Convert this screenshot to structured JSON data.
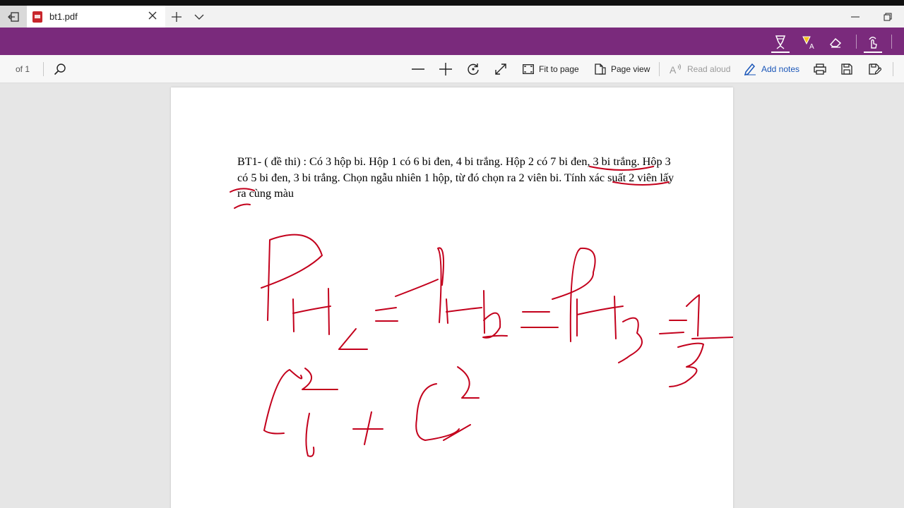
{
  "browser": {
    "tab_title": "bt1.pdf",
    "icons": {
      "back": "set-aside-tabs-icon",
      "favicon": "pdf-file-icon",
      "close": "close-icon",
      "new_tab": "plus-icon",
      "tab_list": "chevron-down-icon",
      "minimize": "minimize-icon",
      "restore": "restore-icon"
    }
  },
  "ink_toolbar": {
    "tools": [
      "ballpoint-pen-icon",
      "highlighter-icon",
      "eraser-icon",
      "touch-writing-icon"
    ],
    "accent_color": "#7a2a7c",
    "ink_color": "#c3001c"
  },
  "pdf_toolbar": {
    "page_count": "of 1",
    "fit_to_page": "Fit to page",
    "page_view": "Page view",
    "read_aloud": "Read aloud",
    "add_notes": "Add notes"
  },
  "document": {
    "text": "BT1- ( đề thi) : Có 3 hộp bi. Hộp 1 có 6 bi đen, 4 bi trắng. Hộp 2 có 7 bi đen, 3 bi trắng. Hộp 3 có 5 bi đen, 3 bi trắng. Chọn ngẫu nhiên 1 hộp, từ đó chọn ra 2 viên bi. Tính xác suất 2 viên lấy ra cùng màu"
  }
}
